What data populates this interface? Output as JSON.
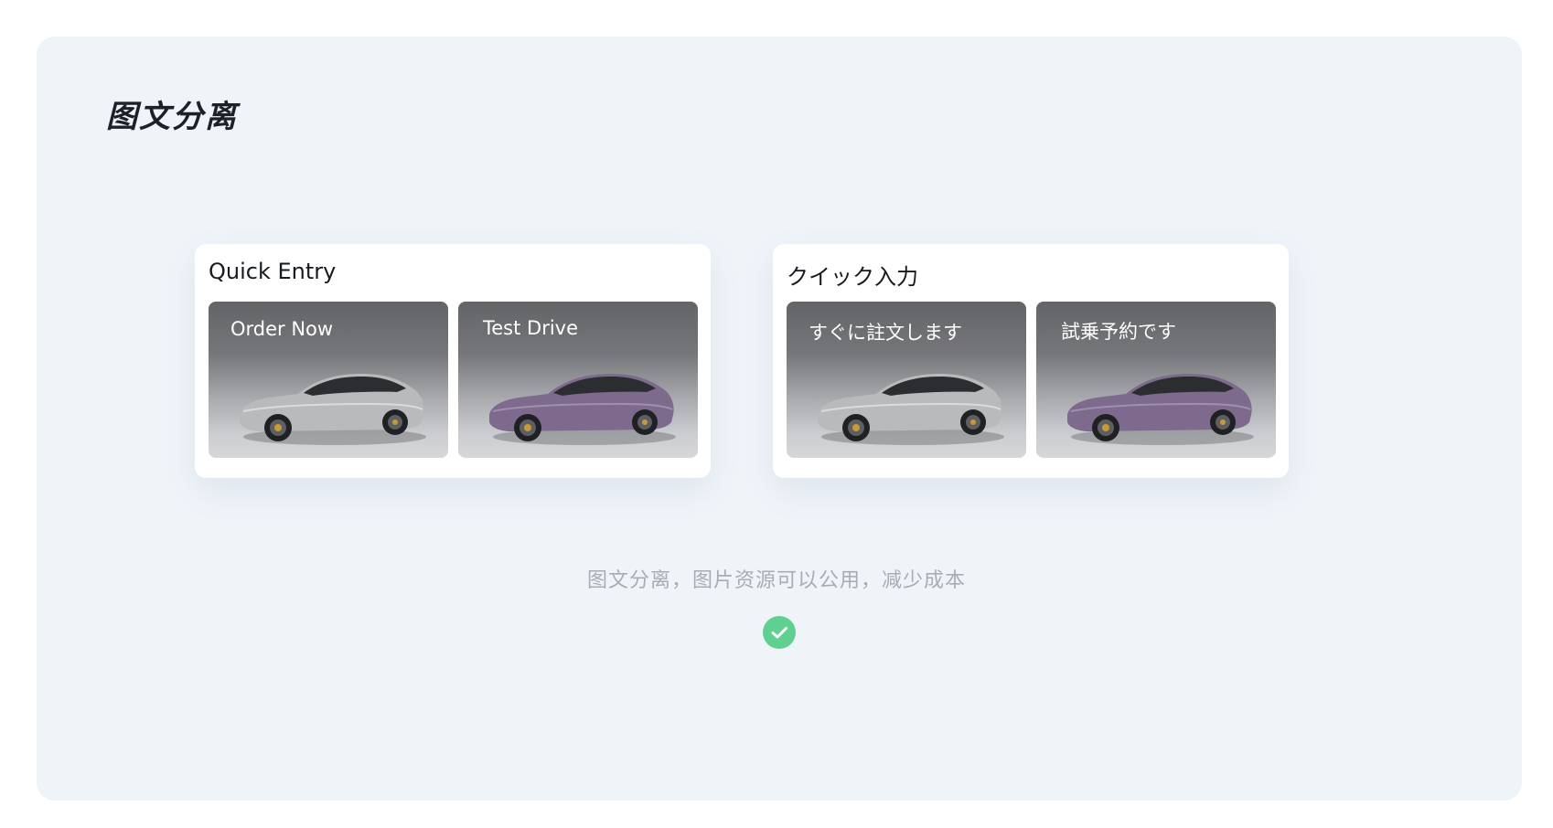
{
  "page": {
    "title": "图文分离",
    "caption": "图文分离，图片资源可以公用，减少成本"
  },
  "cards": [
    {
      "title": "Quick Entry",
      "tiles": [
        {
          "label": "Order Now",
          "car_color": "#b9babc"
        },
        {
          "label": "Test Drive",
          "car_color": "#7d6a8c"
        }
      ]
    },
    {
      "title": "クイック入力",
      "tiles": [
        {
          "label": "すぐに註文します",
          "car_color": "#b9babc"
        },
        {
          "label": "試乗予約です",
          "car_color": "#7d6a8c"
        }
      ]
    }
  ],
  "status": {
    "icon": "check-circle-icon",
    "color": "#5fd08f"
  }
}
